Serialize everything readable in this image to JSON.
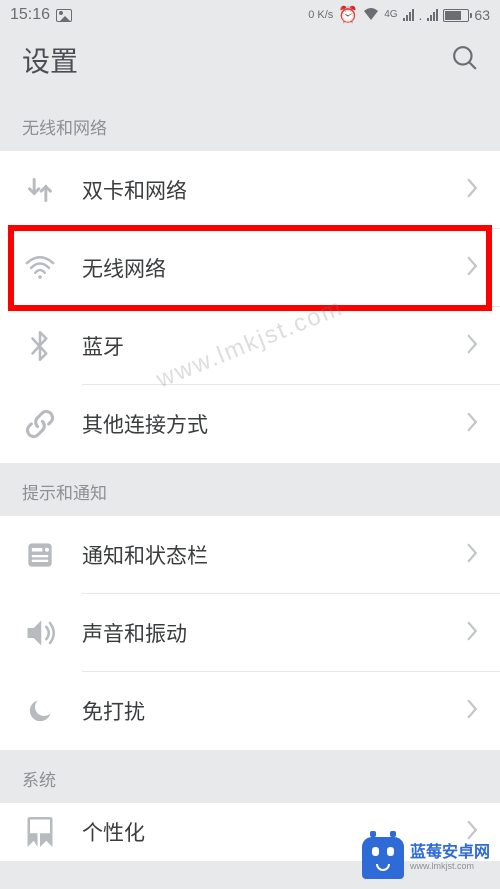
{
  "status": {
    "time": "15:16",
    "speed": "0 K/s",
    "net_gen": "4G",
    "battery": "63"
  },
  "header": {
    "title": "设置"
  },
  "sections": {
    "s0": {
      "header": "无线和网络"
    },
    "s1": {
      "header": "提示和通知"
    },
    "s2": {
      "header": "系统"
    }
  },
  "rows": {
    "sim": "双卡和网络",
    "wifi": "无线网络",
    "bt": "蓝牙",
    "other": "其他连接方式",
    "notif": "通知和状态栏",
    "sound": "声音和振动",
    "dnd": "免打扰",
    "personal": "个性化"
  },
  "watermark": "www.lmkjst.com",
  "footer": {
    "brand_cn": "蓝莓安卓网",
    "brand_en": "www.lmkjst.com"
  },
  "colors": {
    "highlight": "#fd0100",
    "accent": "#2e6bd6"
  }
}
